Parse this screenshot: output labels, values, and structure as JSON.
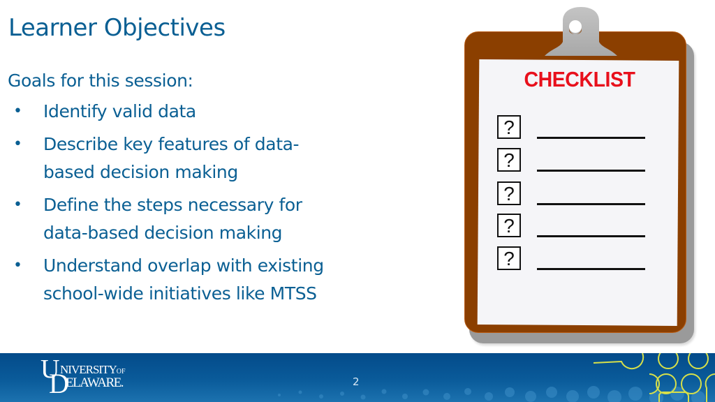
{
  "slide": {
    "title": "Learner Objectives",
    "intro": "Goals for this session:",
    "bullet_glyph": "•",
    "goals": [
      {
        "lines": [
          "Identify valid data"
        ]
      },
      {
        "lines": [
          "Describe key features of data-",
          "based decision making"
        ]
      },
      {
        "lines": [
          "Define the steps necessary for",
          "data-based decision making"
        ]
      },
      {
        "lines": [
          "Understand overlap with existing",
          "school-wide initiatives like MTSS"
        ]
      }
    ]
  },
  "clipboard": {
    "heading": "CHECKLIST",
    "items": [
      {
        "mark": "?"
      },
      {
        "mark": "?"
      },
      {
        "mark": "?"
      },
      {
        "mark": "?"
      },
      {
        "mark": "?"
      }
    ],
    "colors": {
      "board": "#8b3f00",
      "heading": "#e8101c",
      "clip": "#b4b4b4"
    }
  },
  "footer": {
    "logo": {
      "u": "U",
      "line1": "NIVERSITY",
      "of": "OF",
      "d": "D",
      "line2": "ELAWARE."
    },
    "page_number": "2",
    "colors": {
      "band": "#034b8a",
      "accent_rings": "#d7e04a"
    }
  }
}
